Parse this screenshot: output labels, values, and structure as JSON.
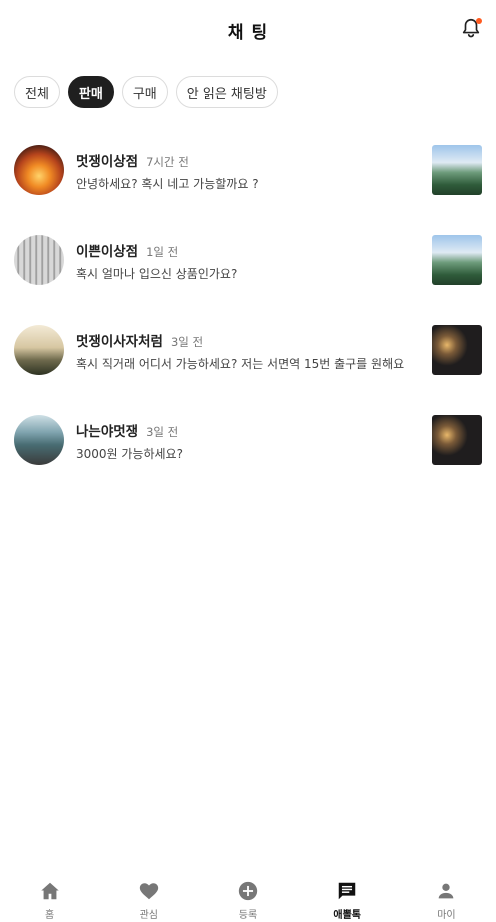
{
  "header": {
    "title": "채 팅",
    "notification_icon": "bell-icon",
    "notification_dot_color": "#ff5a1f"
  },
  "tabs": [
    {
      "label": "전체",
      "active": false
    },
    {
      "label": "판매",
      "active": true
    },
    {
      "label": "구매",
      "active": false
    },
    {
      "label": "안 읽은 채팅방",
      "active": false
    }
  ],
  "chats": [
    {
      "name": "멋쟁이상점",
      "time": "7시간 전",
      "message": "안녕하세요? 혹시 네고 가능할까요 ?",
      "avatar": "sunset-pier",
      "thumbnail": "mountain"
    },
    {
      "name": "이쁜이상점",
      "time": "1일 전",
      "message": "혹시 얼마나 입으신 상품인가요?",
      "avatar": "bridge",
      "thumbnail": "mountain"
    },
    {
      "name": "멋쟁이사자처럼",
      "time": "3일 전",
      "message": "혹시 직거래 어디서 가능하세요? 저는 서면역 15번 출구를 원해요",
      "avatar": "misty-landscape",
      "thumbnail": "city-night"
    },
    {
      "name": "나는야멋쟁",
      "time": "3일 전",
      "message": "3000원 가능하세요?",
      "avatar": "wave",
      "thumbnail": "city-night"
    }
  ],
  "bottom_nav": [
    {
      "label": "홈",
      "icon": "home-icon",
      "active": false
    },
    {
      "label": "관심",
      "icon": "heart-icon",
      "active": false
    },
    {
      "label": "등록",
      "icon": "plus-circle-icon",
      "active": false
    },
    {
      "label": "애뽈톡",
      "icon": "chat-icon",
      "active": true
    },
    {
      "label": "마이",
      "icon": "person-icon",
      "active": false
    }
  ],
  "colors": {
    "active_tab_bg": "#1f1f1f",
    "inactive_nav": "#777777",
    "active_nav": "#111111"
  }
}
